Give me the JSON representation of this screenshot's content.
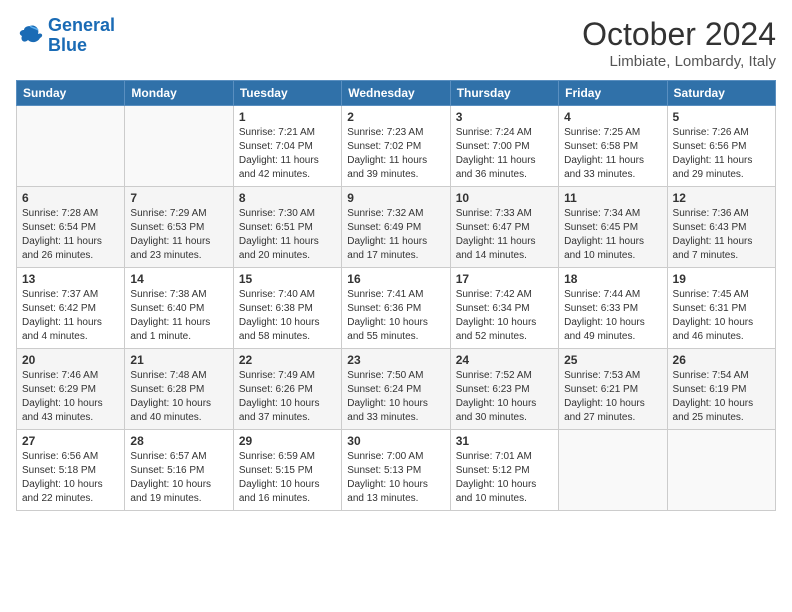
{
  "header": {
    "logo_line1": "General",
    "logo_line2": "Blue",
    "month_title": "October 2024",
    "location": "Limbiate, Lombardy, Italy"
  },
  "weekdays": [
    "Sunday",
    "Monday",
    "Tuesday",
    "Wednesday",
    "Thursday",
    "Friday",
    "Saturday"
  ],
  "weeks": [
    [
      {
        "day": null
      },
      {
        "day": null
      },
      {
        "day": "1",
        "sunrise": "Sunrise: 7:21 AM",
        "sunset": "Sunset: 7:04 PM",
        "daylight": "Daylight: 11 hours and 42 minutes."
      },
      {
        "day": "2",
        "sunrise": "Sunrise: 7:23 AM",
        "sunset": "Sunset: 7:02 PM",
        "daylight": "Daylight: 11 hours and 39 minutes."
      },
      {
        "day": "3",
        "sunrise": "Sunrise: 7:24 AM",
        "sunset": "Sunset: 7:00 PM",
        "daylight": "Daylight: 11 hours and 36 minutes."
      },
      {
        "day": "4",
        "sunrise": "Sunrise: 7:25 AM",
        "sunset": "Sunset: 6:58 PM",
        "daylight": "Daylight: 11 hours and 33 minutes."
      },
      {
        "day": "5",
        "sunrise": "Sunrise: 7:26 AM",
        "sunset": "Sunset: 6:56 PM",
        "daylight": "Daylight: 11 hours and 29 minutes."
      }
    ],
    [
      {
        "day": "6",
        "sunrise": "Sunrise: 7:28 AM",
        "sunset": "Sunset: 6:54 PM",
        "daylight": "Daylight: 11 hours and 26 minutes."
      },
      {
        "day": "7",
        "sunrise": "Sunrise: 7:29 AM",
        "sunset": "Sunset: 6:53 PM",
        "daylight": "Daylight: 11 hours and 23 minutes."
      },
      {
        "day": "8",
        "sunrise": "Sunrise: 7:30 AM",
        "sunset": "Sunset: 6:51 PM",
        "daylight": "Daylight: 11 hours and 20 minutes."
      },
      {
        "day": "9",
        "sunrise": "Sunrise: 7:32 AM",
        "sunset": "Sunset: 6:49 PM",
        "daylight": "Daylight: 11 hours and 17 minutes."
      },
      {
        "day": "10",
        "sunrise": "Sunrise: 7:33 AM",
        "sunset": "Sunset: 6:47 PM",
        "daylight": "Daylight: 11 hours and 14 minutes."
      },
      {
        "day": "11",
        "sunrise": "Sunrise: 7:34 AM",
        "sunset": "Sunset: 6:45 PM",
        "daylight": "Daylight: 11 hours and 10 minutes."
      },
      {
        "day": "12",
        "sunrise": "Sunrise: 7:36 AM",
        "sunset": "Sunset: 6:43 PM",
        "daylight": "Daylight: 11 hours and 7 minutes."
      }
    ],
    [
      {
        "day": "13",
        "sunrise": "Sunrise: 7:37 AM",
        "sunset": "Sunset: 6:42 PM",
        "daylight": "Daylight: 11 hours and 4 minutes."
      },
      {
        "day": "14",
        "sunrise": "Sunrise: 7:38 AM",
        "sunset": "Sunset: 6:40 PM",
        "daylight": "Daylight: 11 hours and 1 minute."
      },
      {
        "day": "15",
        "sunrise": "Sunrise: 7:40 AM",
        "sunset": "Sunset: 6:38 PM",
        "daylight": "Daylight: 10 hours and 58 minutes."
      },
      {
        "day": "16",
        "sunrise": "Sunrise: 7:41 AM",
        "sunset": "Sunset: 6:36 PM",
        "daylight": "Daylight: 10 hours and 55 minutes."
      },
      {
        "day": "17",
        "sunrise": "Sunrise: 7:42 AM",
        "sunset": "Sunset: 6:34 PM",
        "daylight": "Daylight: 10 hours and 52 minutes."
      },
      {
        "day": "18",
        "sunrise": "Sunrise: 7:44 AM",
        "sunset": "Sunset: 6:33 PM",
        "daylight": "Daylight: 10 hours and 49 minutes."
      },
      {
        "day": "19",
        "sunrise": "Sunrise: 7:45 AM",
        "sunset": "Sunset: 6:31 PM",
        "daylight": "Daylight: 10 hours and 46 minutes."
      }
    ],
    [
      {
        "day": "20",
        "sunrise": "Sunrise: 7:46 AM",
        "sunset": "Sunset: 6:29 PM",
        "daylight": "Daylight: 10 hours and 43 minutes."
      },
      {
        "day": "21",
        "sunrise": "Sunrise: 7:48 AM",
        "sunset": "Sunset: 6:28 PM",
        "daylight": "Daylight: 10 hours and 40 minutes."
      },
      {
        "day": "22",
        "sunrise": "Sunrise: 7:49 AM",
        "sunset": "Sunset: 6:26 PM",
        "daylight": "Daylight: 10 hours and 37 minutes."
      },
      {
        "day": "23",
        "sunrise": "Sunrise: 7:50 AM",
        "sunset": "Sunset: 6:24 PM",
        "daylight": "Daylight: 10 hours and 33 minutes."
      },
      {
        "day": "24",
        "sunrise": "Sunrise: 7:52 AM",
        "sunset": "Sunset: 6:23 PM",
        "daylight": "Daylight: 10 hours and 30 minutes."
      },
      {
        "day": "25",
        "sunrise": "Sunrise: 7:53 AM",
        "sunset": "Sunset: 6:21 PM",
        "daylight": "Daylight: 10 hours and 27 minutes."
      },
      {
        "day": "26",
        "sunrise": "Sunrise: 7:54 AM",
        "sunset": "Sunset: 6:19 PM",
        "daylight": "Daylight: 10 hours and 25 minutes."
      }
    ],
    [
      {
        "day": "27",
        "sunrise": "Sunrise: 6:56 AM",
        "sunset": "Sunset: 5:18 PM",
        "daylight": "Daylight: 10 hours and 22 minutes."
      },
      {
        "day": "28",
        "sunrise": "Sunrise: 6:57 AM",
        "sunset": "Sunset: 5:16 PM",
        "daylight": "Daylight: 10 hours and 19 minutes."
      },
      {
        "day": "29",
        "sunrise": "Sunrise: 6:59 AM",
        "sunset": "Sunset: 5:15 PM",
        "daylight": "Daylight: 10 hours and 16 minutes."
      },
      {
        "day": "30",
        "sunrise": "Sunrise: 7:00 AM",
        "sunset": "Sunset: 5:13 PM",
        "daylight": "Daylight: 10 hours and 13 minutes."
      },
      {
        "day": "31",
        "sunrise": "Sunrise: 7:01 AM",
        "sunset": "Sunset: 5:12 PM",
        "daylight": "Daylight: 10 hours and 10 minutes."
      },
      {
        "day": null
      },
      {
        "day": null
      }
    ]
  ]
}
